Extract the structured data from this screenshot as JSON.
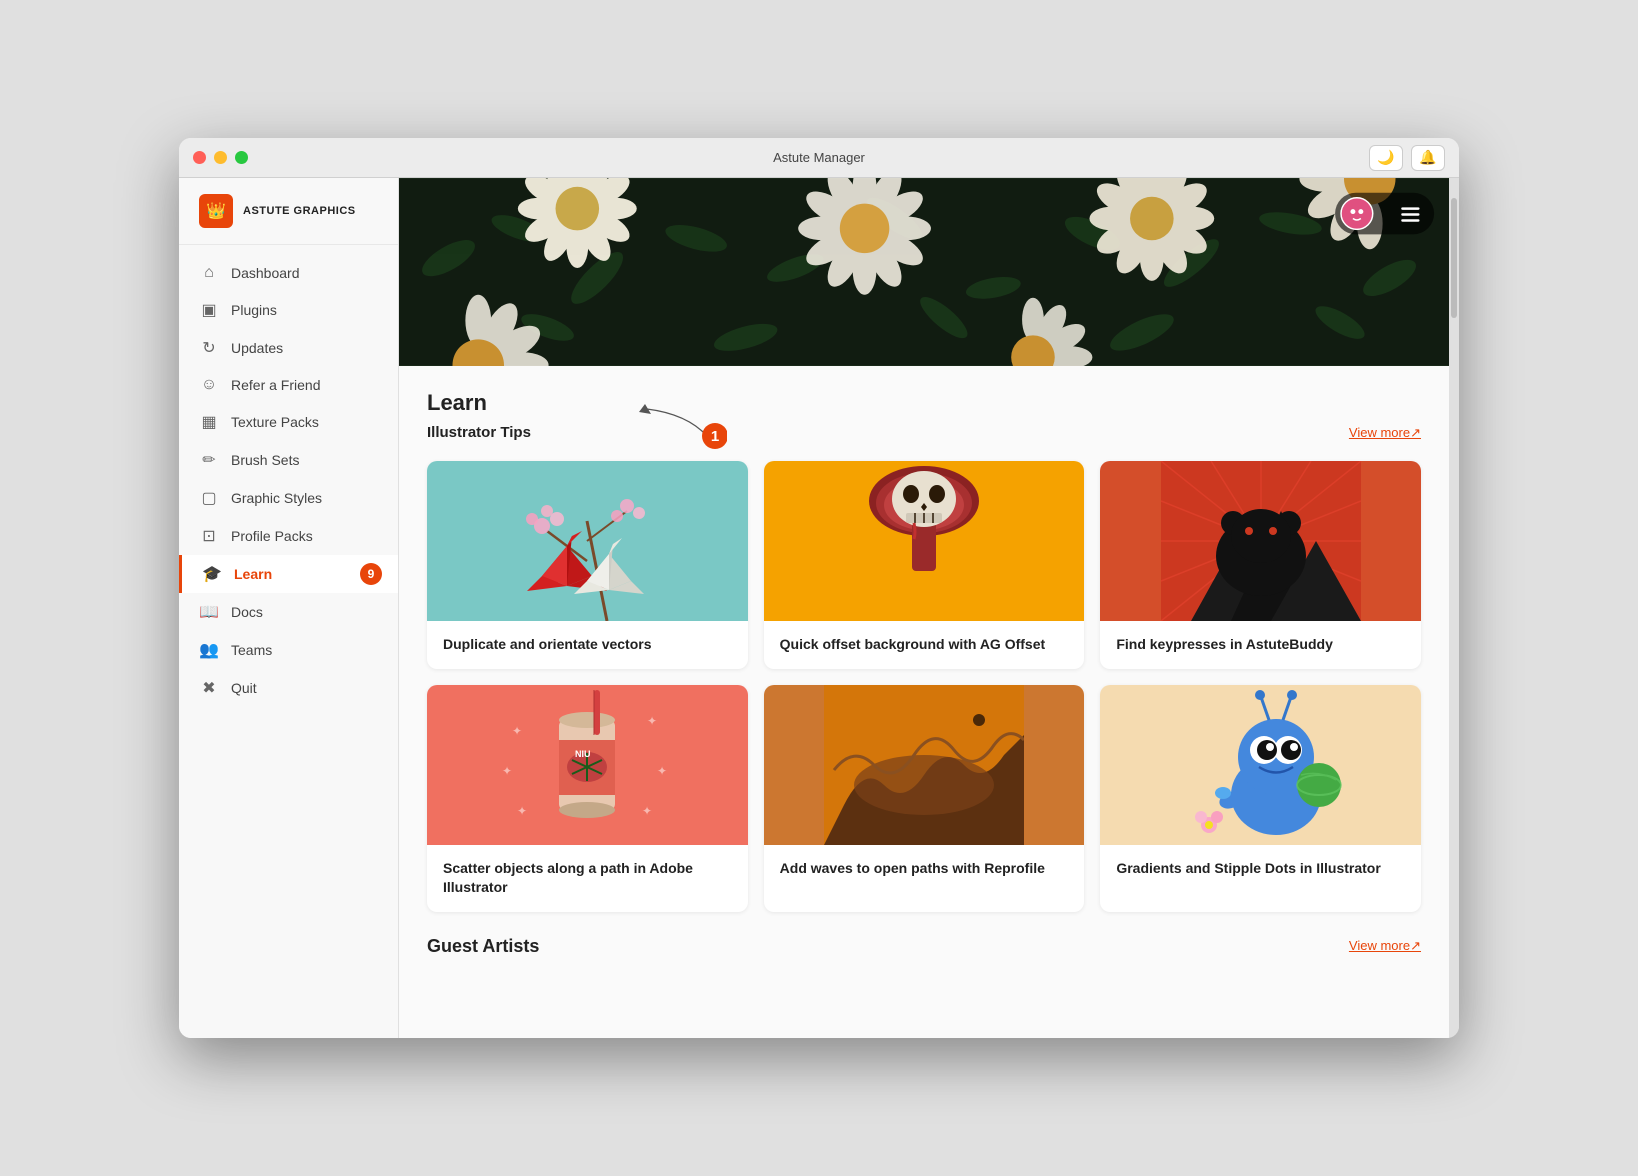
{
  "window": {
    "title": "Astute Manager"
  },
  "logo": {
    "icon": "👑",
    "text": "ASTUTE GRAPHICS"
  },
  "titlebar": {
    "darkmode_label": "🌙",
    "notification_label": "🔔"
  },
  "sidebar": {
    "items": [
      {
        "id": "dashboard",
        "label": "Dashboard",
        "icon": "⌂",
        "active": false
      },
      {
        "id": "plugins",
        "label": "Plugins",
        "icon": "▣",
        "active": false
      },
      {
        "id": "updates",
        "label": "Updates",
        "icon": "↻",
        "active": false
      },
      {
        "id": "refer",
        "label": "Refer a Friend",
        "icon": "☺",
        "active": false
      },
      {
        "id": "texture-packs",
        "label": "Texture Packs",
        "icon": "▦",
        "active": false
      },
      {
        "id": "brush-sets",
        "label": "Brush Sets",
        "icon": "✏",
        "active": false
      },
      {
        "id": "graphic-styles",
        "label": "Graphic Styles",
        "icon": "▢",
        "active": false
      },
      {
        "id": "profile-packs",
        "label": "Profile Packs",
        "icon": "⊡",
        "active": false
      },
      {
        "id": "learn",
        "label": "Learn",
        "icon": "🎓",
        "active": true,
        "badge": "9"
      },
      {
        "id": "docs",
        "label": "Docs",
        "icon": "📖",
        "active": false
      },
      {
        "id": "teams",
        "label": "Teams",
        "icon": "👥",
        "active": false
      },
      {
        "id": "quit",
        "label": "Quit",
        "icon": "✖",
        "active": false
      }
    ]
  },
  "main": {
    "section_title": "Learn",
    "annotation_number": "1",
    "subsection_label": "Illustrator Tips",
    "view_more_label": "View more↗",
    "view_more_label_2": "View more↗",
    "cards": [
      {
        "id": "card-1",
        "title": "Duplicate and orientate vectors",
        "bg_color": "#7ac8c5",
        "emoji": "🦢"
      },
      {
        "id": "card-2",
        "title": "Quick offset background with AG Offset",
        "bg_color": "#f5a200",
        "emoji": "💀"
      },
      {
        "id": "card-3",
        "title": "Find keypresses in AstuteBuddy",
        "bg_color": "#d44e2a",
        "emoji": "🐻"
      },
      {
        "id": "card-4",
        "title": "Scatter objects along a path in Adobe Illustrator",
        "bg_color": "#f07060",
        "emoji": "🥤"
      },
      {
        "id": "card-5",
        "title": "Add waves to open paths with Reprofile",
        "bg_color": "#cc7730",
        "emoji": "🍪"
      },
      {
        "id": "card-6",
        "title": "Gradients and Stipple Dots in Illustrator",
        "bg_color": "#f5dbb0",
        "emoji": "👾"
      }
    ],
    "guest_artists_title": "Guest Artists"
  }
}
